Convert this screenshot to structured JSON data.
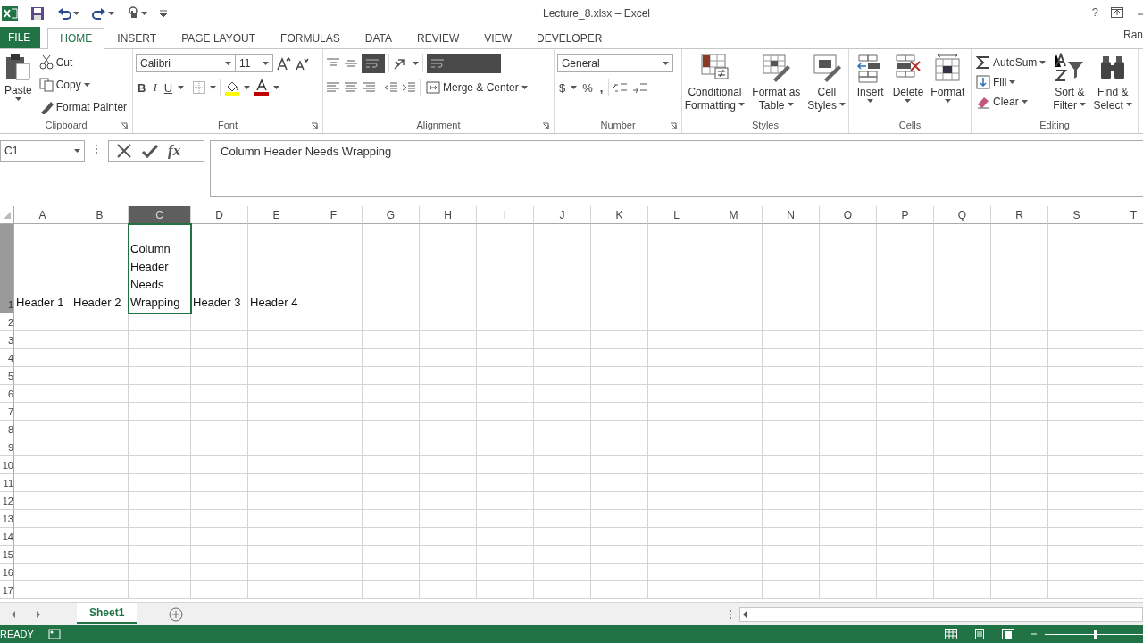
{
  "title_bar": {
    "title": "Lecture_8.xlsx – Excel",
    "help": "?"
  },
  "tabs": [
    {
      "label": "FILE",
      "kind": "file",
      "selected": false
    },
    {
      "label": "HOME",
      "kind": "tab",
      "selected": true
    },
    {
      "label": "INSERT",
      "kind": "tab",
      "selected": false
    },
    {
      "label": "PAGE LAYOUT",
      "kind": "tab",
      "selected": false
    },
    {
      "label": "FORMULAS",
      "kind": "tab",
      "selected": false
    },
    {
      "label": "DATA",
      "kind": "tab",
      "selected": false
    },
    {
      "label": "REVIEW",
      "kind": "tab",
      "selected": false
    },
    {
      "label": "VIEW",
      "kind": "tab",
      "selected": false
    },
    {
      "label": "DEVELOPER",
      "kind": "tab",
      "selected": false
    }
  ],
  "user": "Ran",
  "ribbon": {
    "clipboard": {
      "paste": "Paste",
      "cut": "Cut",
      "copy": "Copy",
      "format_painter": "Format Painter",
      "label": "Clipboard"
    },
    "font": {
      "font_name": "Calibri",
      "font_size": "11",
      "bold": "B",
      "italic": "I",
      "underline": "U",
      "label": "Font"
    },
    "alignment": {
      "merge": "Merge & Center",
      "label": "Alignment"
    },
    "number": {
      "format": "General",
      "currency": "$",
      "percent": "%",
      "comma": ",",
      "label": "Number"
    },
    "styles": {
      "buttons": [
        {
          "lines": [
            "Conditional",
            "Formatting"
          ]
        },
        {
          "lines": [
            "Format as",
            "Table"
          ]
        },
        {
          "lines": [
            "Cell",
            "Styles"
          ]
        }
      ],
      "label": "Styles"
    },
    "cells": {
      "buttons": [
        "Insert",
        "Delete",
        "Format"
      ],
      "label": "Cells"
    },
    "editing": {
      "autosum": "AutoSum",
      "fill": "Fill",
      "clear": "Clear",
      "sort": [
        "Sort &",
        "Filter"
      ],
      "find": [
        "Find &",
        "Select"
      ],
      "label": "Editing"
    }
  },
  "formula_bar": {
    "name_box": "C1",
    "fx": "fx",
    "content": "Column Header Needs Wrapping"
  },
  "sheet": {
    "columns": [
      {
        "label": "A",
        "selected": false
      },
      {
        "label": "B",
        "selected": false
      },
      {
        "label": "C",
        "selected": true
      },
      {
        "label": "D",
        "selected": false
      },
      {
        "label": "E",
        "selected": false
      },
      {
        "label": "F",
        "selected": false
      },
      {
        "label": "G",
        "selected": false
      },
      {
        "label": "H",
        "selected": false
      },
      {
        "label": "I",
        "selected": false
      },
      {
        "label": "J",
        "selected": false
      },
      {
        "label": "K",
        "selected": false
      },
      {
        "label": "L",
        "selected": false
      },
      {
        "label": "M",
        "selected": false
      },
      {
        "label": "N",
        "selected": false
      },
      {
        "label": "O",
        "selected": false
      },
      {
        "label": "P",
        "selected": false
      },
      {
        "label": "Q",
        "selected": false
      },
      {
        "label": "R",
        "selected": false
      },
      {
        "label": "S",
        "selected": false
      },
      {
        "label": "T",
        "selected": false
      }
    ],
    "rows": [
      {
        "label": "1",
        "selected": true,
        "cells": [
          "Header 1",
          "Header 2",
          "Column Header Needs Wrapping",
          "Header 3",
          "Header 4"
        ]
      },
      {
        "label": "2",
        "selected": false
      },
      {
        "label": "3",
        "selected": false
      },
      {
        "label": "4",
        "selected": false
      },
      {
        "label": "5",
        "selected": false
      },
      {
        "label": "6",
        "selected": false
      },
      {
        "label": "7",
        "selected": false
      },
      {
        "label": "8",
        "selected": false
      },
      {
        "label": "9",
        "selected": false
      },
      {
        "label": "10",
        "selected": false
      },
      {
        "label": "11",
        "selected": false
      },
      {
        "label": "12",
        "selected": false
      },
      {
        "label": "13",
        "selected": false
      },
      {
        "label": "14",
        "selected": false
      },
      {
        "label": "15",
        "selected": false
      },
      {
        "label": "16",
        "selected": false
      },
      {
        "label": "17",
        "selected": false
      }
    ]
  },
  "sheet_tabs": [
    {
      "label": "Sheet1",
      "selected": true
    }
  ],
  "status_bar": {
    "mode": "READY",
    "zoom": {
      "level": 0.5
    }
  }
}
